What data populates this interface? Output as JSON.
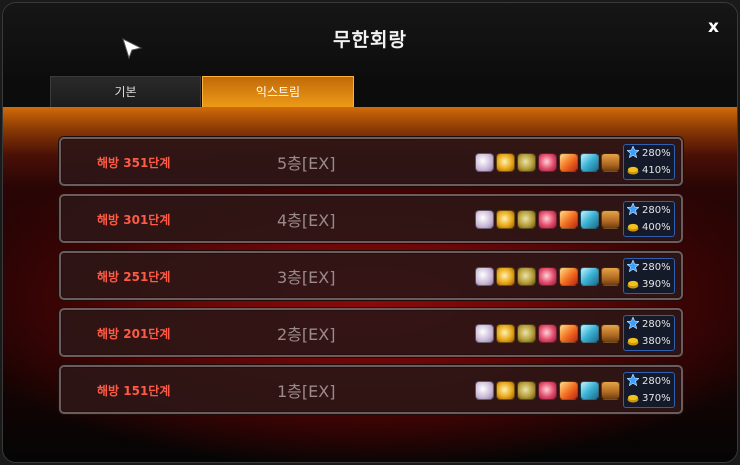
{
  "window": {
    "title": "무한회랑",
    "close_label": "x"
  },
  "tabs": [
    {
      "label": "기본",
      "active": false
    },
    {
      "label": "익스트림",
      "active": true
    }
  ],
  "rows": [
    {
      "stage": "해방 351단계",
      "floor": "5층[EX]",
      "exp_bonus": "280%",
      "gold_bonus": "410%"
    },
    {
      "stage": "해방 301단계",
      "floor": "4층[EX]",
      "exp_bonus": "280%",
      "gold_bonus": "400%"
    },
    {
      "stage": "해방 251단계",
      "floor": "3층[EX]",
      "exp_bonus": "280%",
      "gold_bonus": "390%"
    },
    {
      "stage": "해방 201단계",
      "floor": "2층[EX]",
      "exp_bonus": "280%",
      "gold_bonus": "380%"
    },
    {
      "stage": "해방 151단계",
      "floor": "1층[EX]",
      "exp_bonus": "280%",
      "gold_bonus": "370%"
    }
  ],
  "reward_icons": [
    "dice-icon",
    "gold-pouch-icon",
    "coin-icon",
    "pink-orb-icon",
    "fire-scroll-icon",
    "blue-book-icon",
    "treasure-chest-icon"
  ],
  "colors": {
    "stage_text": "#ff5a45",
    "active_tab": "#ee9a18",
    "exp_star": "#3aa0ff",
    "gold": "#f2c21a"
  }
}
